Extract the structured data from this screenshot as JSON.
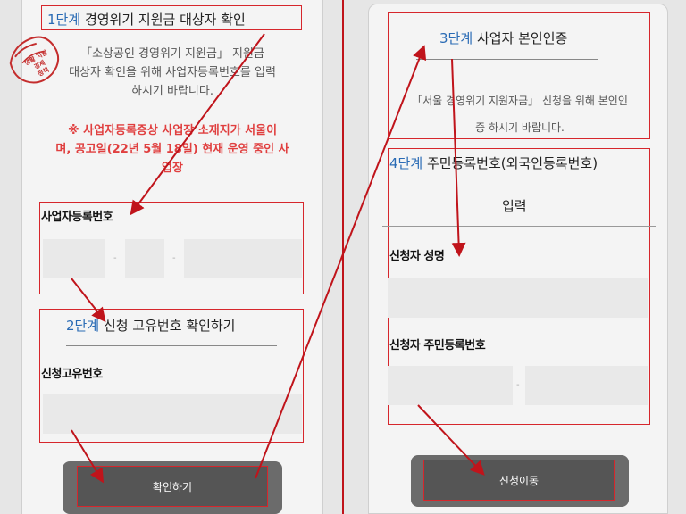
{
  "step1": {
    "num": "1단계",
    "title": "경영위기 지원금 대상자 확인",
    "desc_lines": [
      "「소상공인 경영위기 지원금」 지원금",
      "대상자 확인을 위해 사업자등록번호를 입력",
      "하시기 바랍니다."
    ],
    "warn_lines": [
      "※ 사업자등록증상 사업장 소재지가 서울이",
      "며, 공고일(22년 5월 18일) 현재 운영 중인 사",
      "업장"
    ],
    "field_label": "사업자등록번호",
    "sep": "-"
  },
  "step2": {
    "num": "2단계",
    "title": "신청 고유번호 확인하기",
    "field_label": "신청고유번호"
  },
  "confirm_button": "확인하기",
  "step3": {
    "num": "3단계",
    "title": "사업자 본인인증",
    "desc_lines": [
      "「서울 경영위기 지원자금」 신청을 위해 본인인",
      "증 하시기 바랍니다."
    ]
  },
  "step4": {
    "num": "4단계",
    "title": "주민등록번호(외국인등록번호)",
    "title_line2": "입력",
    "name_label": "신청자 성명",
    "rrn_label": "신청자 주민등록번호",
    "sep": "-"
  },
  "apply_button": "신청이동",
  "stamp_text": [
    "생활 지원",
    "경제",
    "정책"
  ],
  "colors": {
    "highlight": "#d6262c",
    "step_num": "#2a6bb5",
    "warning": "#e03f3f"
  }
}
